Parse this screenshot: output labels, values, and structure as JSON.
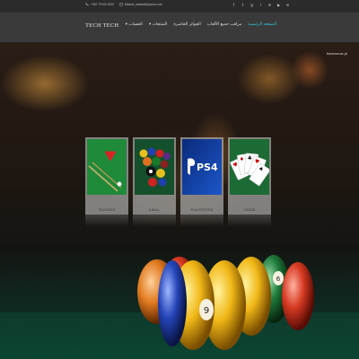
{
  "topbar": {
    "phone": "+962 79 000 3030",
    "email": "billiards_alabdali@yahoo.com",
    "social_icons": [
      "facebook-icon",
      "twitter-icon",
      "google-plus-icon",
      "instagram-icon",
      "linkedin-icon",
      "youtube-icon",
      "rss-icon"
    ],
    "social_glyphs": [
      "f",
      "t",
      "g",
      "i",
      "in",
      "▶",
      "≋"
    ]
  },
  "navbar": {
    "logo": "TECH TECH",
    "menu": [
      {
        "label": "الصفحة الرئيسية",
        "active": true
      },
      {
        "label": "مراقب جميع الألعاب",
        "active": false
      },
      {
        "label": "الجوائز الحاصرة",
        "active": false
      },
      {
        "label": "المنتجات ▾",
        "active": false
      },
      {
        "label": "الحساب ▾",
        "active": false
      }
    ],
    "active_color": "#33c6d6"
  },
  "hero": {
    "watermark": "fotocronos.pl"
  },
  "tiles": [
    {
      "caption": "SNOOKER",
      "image": "snooker-table-icon"
    },
    {
      "caption": "8 BALL",
      "image": "pool-balls-icon"
    },
    {
      "caption": "PLAYSTATION",
      "image": "ps4-logo-icon"
    },
    {
      "caption": "CARDS",
      "image": "playing-cards-icon"
    }
  ]
}
